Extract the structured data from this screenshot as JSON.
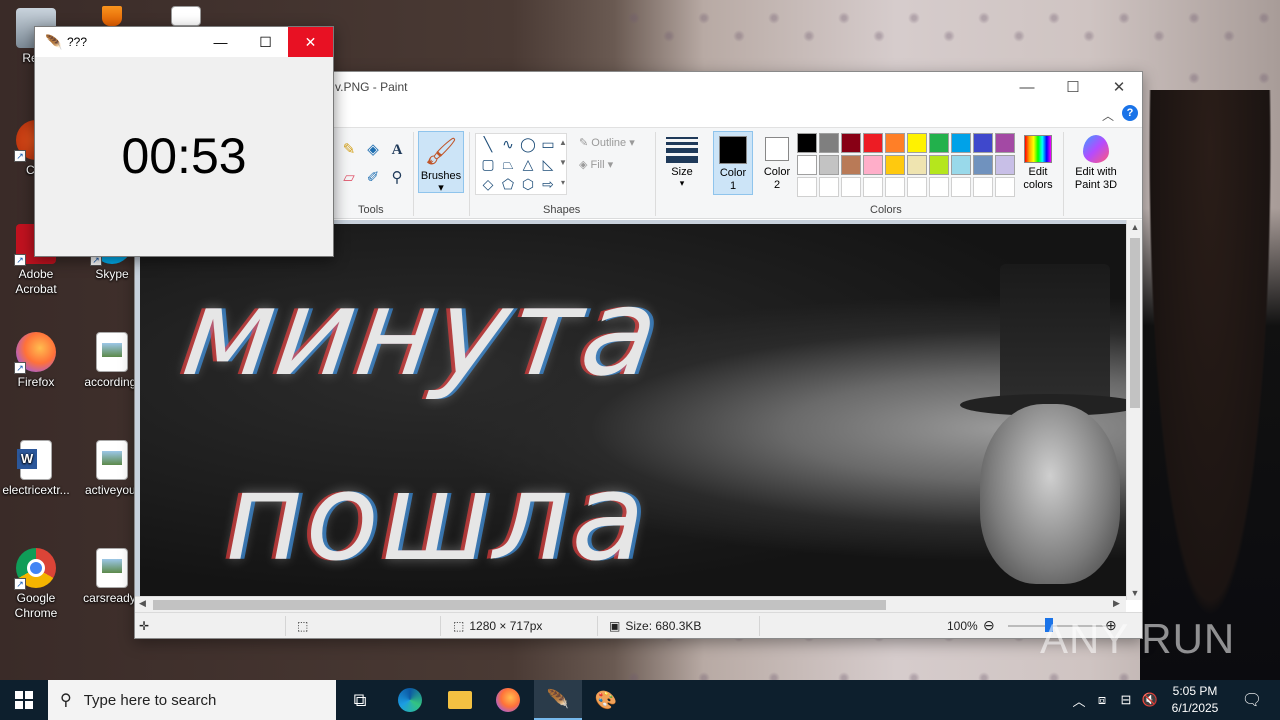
{
  "desktop": {
    "icons": [
      {
        "label": "Recy",
        "icon": "recycle-bin-icon"
      },
      {
        "label": "CCl",
        "icon": "ccleaner-icon"
      },
      {
        "label": "Adobe Acrobat",
        "icon": "adobe-acrobat-icon"
      },
      {
        "label": "Skype",
        "icon": "skype-icon"
      },
      {
        "label": "Firefox",
        "icon": "firefox-icon"
      },
      {
        "label": "according.",
        "icon": "image-file-icon"
      },
      {
        "label": "electricextr...",
        "icon": "word-document-icon"
      },
      {
        "label": "activeyout",
        "icon": "image-file-icon"
      },
      {
        "label": "Google Chrome",
        "icon": "chrome-icon"
      },
      {
        "label": "carsready.j",
        "icon": "image-file-icon"
      }
    ]
  },
  "timer_window": {
    "title": "???",
    "time": "00:53",
    "controls": {
      "minimize": "—",
      "maximize": "☐",
      "close": "✕"
    }
  },
  "paint": {
    "title": "v.PNG - Paint",
    "controls": {
      "minimize": "—",
      "maximize": "☐",
      "close": "✕"
    },
    "help": "?",
    "ribbon": {
      "tools_label": "Tools",
      "brushes_label": "Brushes",
      "shapes_label": "Shapes",
      "outline_label": "Outline",
      "fill_label": "Fill",
      "size_label": "Size",
      "color1_label": "Color 1",
      "color2_label": "Color 2",
      "colors_label": "Colors",
      "edit_colors_label": "Edit colors",
      "paint3d_label": "Edit with Paint 3D",
      "palette_row1": [
        "#000000",
        "#7f7f7f",
        "#880015",
        "#ed1c24",
        "#ff7f27",
        "#fff200",
        "#22b14c",
        "#00a2e8",
        "#3f48cc",
        "#a349a4"
      ],
      "palette_row2": [
        "#ffffff",
        "#c3c3c3",
        "#b97a57",
        "#ffaec9",
        "#ffc90e",
        "#efe4b0",
        "#b5e61d",
        "#99d9ea",
        "#7092be",
        "#c8bfe7"
      ],
      "palette_row3": [
        "#ffffff",
        "#ffffff",
        "#ffffff",
        "#ffffff",
        "#ffffff",
        "#ffffff",
        "#ffffff",
        "#ffffff",
        "#ffffff",
        "#ffffff"
      ],
      "color1": "#000000",
      "color2": "#ffffff"
    },
    "canvas": {
      "line1": "минута",
      "line2": "пошла"
    },
    "status": {
      "dimensions": "1280 × 717px",
      "size": "Size: 680.3KB",
      "zoom": "100%"
    }
  },
  "watermark": "ANY RUN",
  "taskbar": {
    "search_placeholder": "Type here to search",
    "time": "5:05 PM",
    "date": "6/1/2025"
  }
}
